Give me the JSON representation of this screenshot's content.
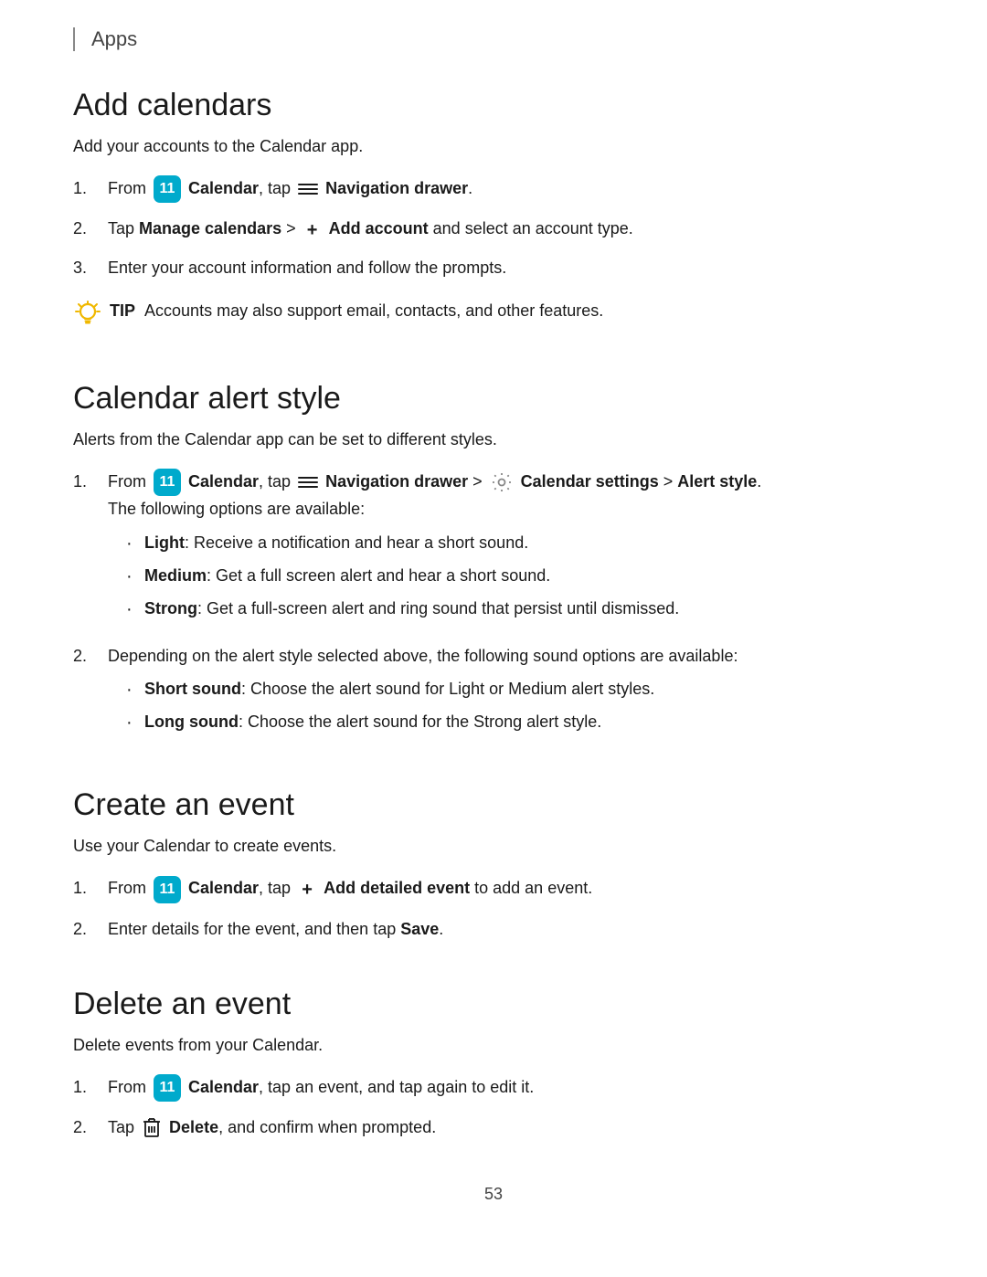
{
  "header": {
    "title": "Apps",
    "border_color": "#888888"
  },
  "sections": [
    {
      "id": "add-calendars",
      "title": "Add calendars",
      "subtitle": "Add your accounts to the Calendar app.",
      "steps": [
        {
          "number": "1.",
          "html_key": "add_cal_step1"
        },
        {
          "number": "2.",
          "html_key": "add_cal_step2"
        },
        {
          "number": "3.",
          "html_key": "add_cal_step3",
          "text": "Enter your account information and follow the prompts."
        }
      ],
      "tip": {
        "label": "TIP",
        "text": "Accounts may also support email, contacts, and other features."
      }
    },
    {
      "id": "calendar-alert-style",
      "title": "Calendar alert style",
      "subtitle": "Alerts from the Calendar app can be set to different styles.",
      "steps": [
        {
          "number": "1.",
          "html_key": "alert_step1",
          "sub_intro": "The following options are available:",
          "bullets": [
            {
              "bold": "Light",
              "text": ": Receive a notification and hear a short sound."
            },
            {
              "bold": "Medium",
              "text": ": Get a full screen alert and hear a short sound."
            },
            {
              "bold": "Strong",
              "text": ": Get a full-screen alert and ring sound that persist until dismissed."
            }
          ]
        },
        {
          "number": "2.",
          "text": "Depending on the alert style selected above, the following sound options are available:",
          "bullets": [
            {
              "bold": "Short sound",
              "text": ": Choose the alert sound for Light or Medium alert styles."
            },
            {
              "bold": "Long sound",
              "text": ": Choose the alert sound for the Strong alert style."
            }
          ]
        }
      ]
    },
    {
      "id": "create-event",
      "title": "Create an event",
      "subtitle": "Use your Calendar to create events.",
      "steps": [
        {
          "number": "1.",
          "html_key": "create_step1"
        },
        {
          "number": "2.",
          "html_key": "create_step2"
        }
      ]
    },
    {
      "id": "delete-event",
      "title": "Delete an event",
      "subtitle": "Delete events from your Calendar.",
      "steps": [
        {
          "number": "1.",
          "html_key": "delete_step1"
        },
        {
          "number": "2.",
          "html_key": "delete_step2"
        }
      ]
    }
  ],
  "page_number": "53",
  "icons": {
    "calendar_label": "11",
    "calendar_bg": "#00aacc",
    "add_symbol": "+",
    "nav_drawer_label": "≡"
  }
}
